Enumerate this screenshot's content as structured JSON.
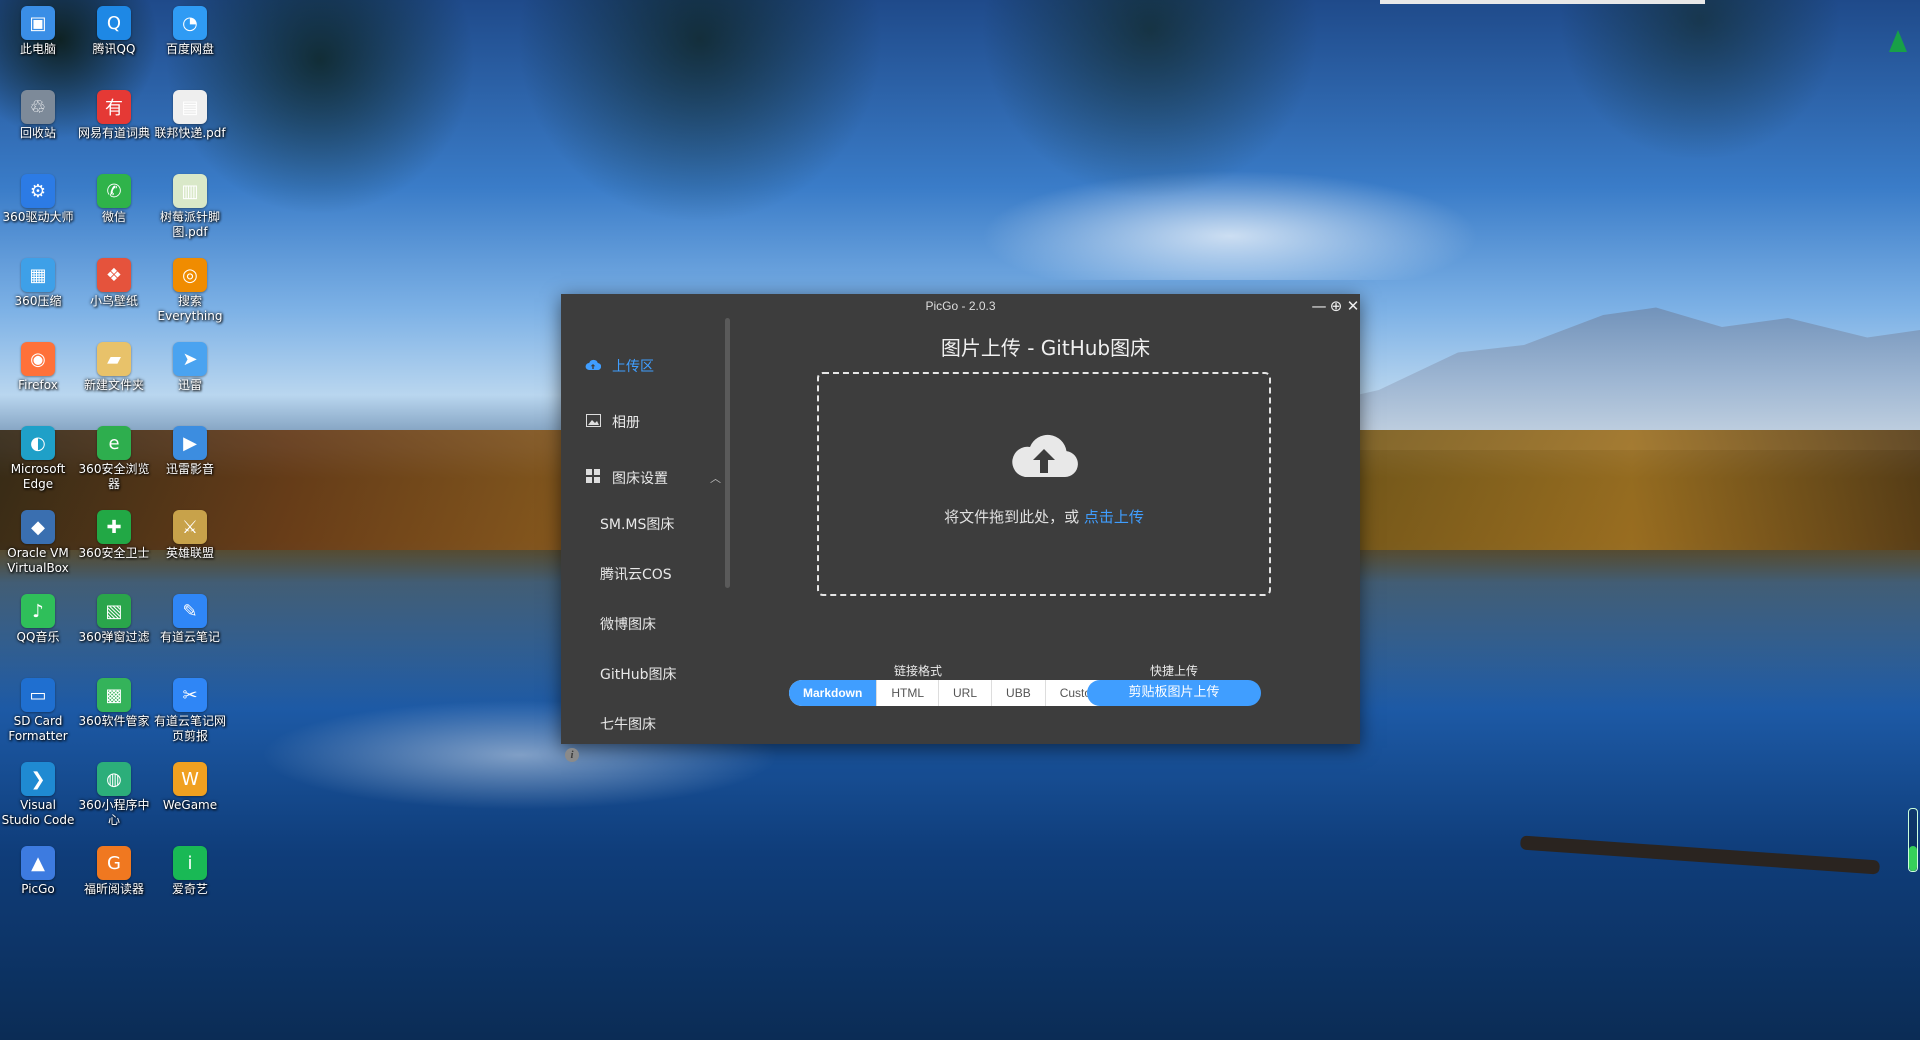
{
  "desktop": {
    "icons": [
      {
        "label": "此电脑",
        "glyph": "▣",
        "color": "#3a8ee6"
      },
      {
        "label": "腾讯QQ",
        "glyph": "Q",
        "color": "#1e88e5"
      },
      {
        "label": "百度网盘",
        "glyph": "◔",
        "color": "#2f9bf4"
      },
      {
        "label": "回收站",
        "glyph": "♲",
        "color": "#7d8a99"
      },
      {
        "label": "网易有道词典",
        "glyph": "有",
        "color": "#e53935"
      },
      {
        "label": "联邦快递.pdf",
        "glyph": "▤",
        "color": "#eeeeee"
      },
      {
        "label": "360驱动大师",
        "glyph": "⚙",
        "color": "#2c7be5"
      },
      {
        "label": "微信",
        "glyph": "✆",
        "color": "#2fb34a"
      },
      {
        "label": "树莓派针脚图.pdf",
        "glyph": "▥",
        "color": "#d9e8c8"
      },
      {
        "label": "360压缩",
        "glyph": "▦",
        "color": "#3ea0e8"
      },
      {
        "label": "小鸟壁纸",
        "glyph": "❖",
        "color": "#e5533c"
      },
      {
        "label": "搜索Everything",
        "glyph": "◎",
        "color": "#f08c00"
      },
      {
        "label": "Firefox",
        "glyph": "◉",
        "color": "#ff7139"
      },
      {
        "label": "新建文件夹",
        "glyph": "▰",
        "color": "#e8c26a"
      },
      {
        "label": "迅雷",
        "glyph": "➤",
        "color": "#4aa3f0"
      },
      {
        "label": "Microsoft Edge",
        "glyph": "◐",
        "color": "#1fa0c8"
      },
      {
        "label": "360安全浏览器",
        "glyph": "e",
        "color": "#2eae4e"
      },
      {
        "label": "迅雷影音",
        "glyph": "▶",
        "color": "#3c8de0"
      },
      {
        "label": "Oracle VM VirtualBox",
        "glyph": "◆",
        "color": "#3a6fb0"
      },
      {
        "label": "360安全卫士",
        "glyph": "✚",
        "color": "#22a845"
      },
      {
        "label": "英雄联盟",
        "glyph": "⚔",
        "color": "#c8a24a"
      },
      {
        "label": "QQ音乐",
        "glyph": "♪",
        "color": "#2fbf5a"
      },
      {
        "label": "360弹窗过滤",
        "glyph": "▧",
        "color": "#2aa54b"
      },
      {
        "label": "有道云笔记",
        "glyph": "✎",
        "color": "#2f86f6"
      },
      {
        "label": "SD Card Formatter",
        "glyph": "▭",
        "color": "#1f6fd0"
      },
      {
        "label": "360软件管家",
        "glyph": "▩",
        "color": "#34b35a"
      },
      {
        "label": "有道云笔记网页剪报",
        "glyph": "✂",
        "color": "#2f86f6"
      },
      {
        "label": "Visual Studio Code",
        "glyph": "❯",
        "color": "#1f8ad2"
      },
      {
        "label": "360小程序中心",
        "glyph": "◍",
        "color": "#2cae7a"
      },
      {
        "label": "WeGame",
        "glyph": "W",
        "color": "#f0a020"
      },
      {
        "label": "PicGo",
        "glyph": "▲",
        "color": "#3d7be0"
      },
      {
        "label": "福昕阅读器",
        "glyph": "G",
        "color": "#f07820"
      },
      {
        "label": "爱奇艺",
        "glyph": "i",
        "color": "#19b955"
      }
    ]
  },
  "window": {
    "title": "PicGo - 2.0.3",
    "controls": {
      "minimize": "—",
      "pin": "⊕",
      "close": "✕"
    }
  },
  "sidebar": {
    "upload": {
      "label": "上传区",
      "icon": "cloud-upload-icon"
    },
    "album": {
      "label": "相册",
      "icon": "picture-icon"
    },
    "settings": {
      "label": "图床设置",
      "icon": "grid-icon",
      "expanded": true
    },
    "sub_items": [
      "SM.MS图床",
      "腾讯云COS",
      "微博图床",
      "GitHub图床",
      "七牛图床"
    ],
    "info_glyph": "i"
  },
  "main": {
    "title": "图片上传 - GitHub图床",
    "drop_text": "将文件拖到此处，或 ",
    "drop_link": "点击上传",
    "link_format_label": "链接格式",
    "formats": [
      "Markdown",
      "HTML",
      "URL",
      "UBB",
      "Custom"
    ],
    "active_format": "Markdown",
    "quick_upload_label": "快捷上传",
    "quick_upload_button": "剪贴板图片上传",
    "accent": "#409eff"
  }
}
